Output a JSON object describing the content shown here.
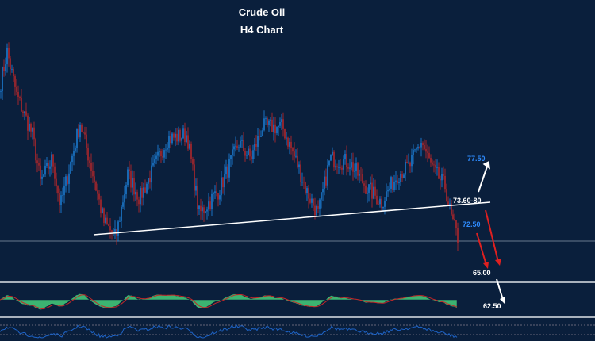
{
  "chart_data": {
    "type": "candlestick",
    "title": "Crude Oil",
    "subtitle": "H4 Chart",
    "price_path": [
      [
        0,
        89.0
      ],
      [
        8,
        92.9
      ],
      [
        20,
        87.4
      ],
      [
        40,
        82.4
      ],
      [
        50,
        76.4
      ],
      [
        65,
        79.4
      ],
      [
        75,
        73.4
      ],
      [
        100,
        83.9
      ],
      [
        115,
        77.9
      ],
      [
        130,
        71.4
      ],
      [
        145,
        69.4
      ],
      [
        160,
        77.4
      ],
      [
        175,
        74.4
      ],
      [
        210,
        81.9
      ],
      [
        235,
        82.4
      ],
      [
        250,
        72.4
      ],
      [
        275,
        75.4
      ],
      [
        300,
        81.4
      ],
      [
        315,
        79.4
      ],
      [
        330,
        83.4
      ],
      [
        355,
        83.4
      ],
      [
        375,
        78.4
      ],
      [
        385,
        75.4
      ],
      [
        400,
        72.4
      ],
      [
        415,
        79.4
      ],
      [
        440,
        78.9
      ],
      [
        460,
        75.9
      ],
      [
        480,
        73.9
      ],
      [
        500,
        77.4
      ],
      [
        515,
        78.4
      ],
      [
        530,
        81.6
      ],
      [
        545,
        77.9
      ],
      [
        560,
        75.9
      ],
      [
        568,
        71.9
      ],
      [
        576,
        69.4
      ]
    ],
    "trendline": {
      "from": [
        118,
        69.8
      ],
      "to": [
        618,
        73.9
      ]
    },
    "support_level": 69.0,
    "annotations": [
      {
        "text": "77.50",
        "price": 77.5,
        "color": "#2f8cff"
      },
      {
        "text": "73.60-80",
        "price": 73.6,
        "color": "#ffffff"
      },
      {
        "text": "72.50",
        "price": 72.5,
        "color": "#2f8cff"
      },
      {
        "text": "65.00",
        "price": 65.0,
        "color": "#ffffff"
      },
      {
        "text": "62.50",
        "price": 62.5,
        "color": "#ffffff"
      }
    ],
    "colors": {
      "up": "#1e88e5",
      "down": "#c62828",
      "osc_fill": "#3cb371",
      "osc_signal": "#c62828",
      "rsi": "#1e64c8",
      "background": "#0a1f3c"
    }
  }
}
